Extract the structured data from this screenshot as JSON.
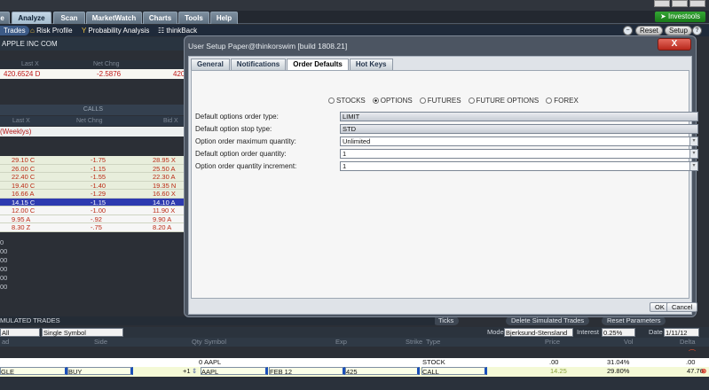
{
  "menu": {
    "tabs": [
      {
        "label": "le"
      },
      {
        "label": "Analyze"
      },
      {
        "label": "Scan"
      },
      {
        "label": "MarketWatch"
      },
      {
        "label": "Charts"
      },
      {
        "label": "Tools"
      },
      {
        "label": "Help"
      }
    ],
    "investools_label": "Investools"
  },
  "subtabs": {
    "trades": "Trades",
    "risk_profile": "Risk Profile",
    "probability": "Probability Analysis",
    "thinkback": "thinkBack",
    "reset": "Reset",
    "setup": "Setup"
  },
  "left": {
    "symbol": "APPLE INC COM",
    "quote_headers": {
      "last": "Last X",
      "net": "Net Chng"
    },
    "quote": {
      "last": "420.6524 D",
      "net": "-2.5876",
      "extra": "420"
    },
    "calls_label": "CALLS",
    "col_headers": {
      "last": "Last X",
      "net": "Net Chng",
      "bid": "Bid X"
    },
    "weeklys": "(Weeklys)",
    "chain": [
      {
        "last": "29.10 C",
        "net": "-1.75",
        "bid": "28.95 X"
      },
      {
        "last": "26.00 C",
        "net": "-1.15",
        "bid": "25.50 A"
      },
      {
        "last": "22.40 C",
        "net": "-1.55",
        "bid": "22.30 A"
      },
      {
        "last": "19.40 C",
        "net": "-1.40",
        "bid": "19.35 N"
      },
      {
        "last": "16.66 A",
        "net": "-1.29",
        "bid": "16.60 X"
      },
      {
        "last": "14.15 C",
        "net": "-1.15",
        "bid": "14.10 A"
      },
      {
        "last": "12.00 C",
        "net": "-1.00",
        "bid": "11.90 X"
      },
      {
        "last": "9.95 A",
        "net": "-.92",
        "bid": "9.90 A"
      },
      {
        "last": "8.30 Z",
        "net": "-.75",
        "bid": "8.20 A"
      }
    ],
    "zeros": [
      "0",
      "00",
      "00",
      "00",
      "00",
      "00"
    ]
  },
  "dialog": {
    "title": "User Setup Paper@thinkorswim [build 1808.21]",
    "close_label": "X",
    "tabs": [
      {
        "label": "General"
      },
      {
        "label": "Notifications"
      },
      {
        "label": "Order Defaults"
      },
      {
        "label": "Hot Keys"
      }
    ],
    "asset_types": [
      {
        "label": "STOCKS"
      },
      {
        "label": "OPTIONS"
      },
      {
        "label": "FUTURES"
      },
      {
        "label": "FUTURE OPTIONS"
      },
      {
        "label": "FOREX"
      }
    ],
    "fields": [
      {
        "label": "Default options order type:",
        "value": "LIMIT"
      },
      {
        "label": "Default option stop type:",
        "value": "STD"
      },
      {
        "label": "Option order maximum quantity:",
        "value": "Unlimited"
      },
      {
        "label": "Default option order quantity:",
        "value": "1"
      },
      {
        "label": "Option order quantity increment:",
        "value": "1"
      }
    ],
    "ok_label": "OK",
    "cancel_label": "Cancel"
  },
  "behind": {
    "delete_label": "Delete Simulated Trades",
    "reset_params": "Reset Parameters",
    "ticks_label": "Ticks"
  },
  "sim": {
    "header": "MULATED TRADES",
    "filter_all": "All",
    "filter_symbol": "Single Symbol",
    "model_label": "Model",
    "model_value": "Bjerksund-Stensland",
    "interest_label": "Interest",
    "interest_value": "0.25%",
    "date_label": "Date",
    "date_value": "1/11/12",
    "columns": {
      "trade": "ad",
      "side": "Side",
      "qty": "Qty",
      "symbol": "Symbol",
      "exp": "Exp",
      "strike": "Strike",
      "type": "Type",
      "price": "Price",
      "vol": "Vol",
      "delta": "Delta"
    },
    "rows": [
      {
        "trade": "",
        "side": "",
        "qty": "0",
        "symbol": "AAPL",
        "exp": "",
        "strike": "",
        "type": "STOCK",
        "price": ".00",
        "vol": "31.04%",
        "delta": ".00"
      },
      {
        "trade": "GLE",
        "side": "BUY",
        "qty": "+1",
        "symbol": "AAPL",
        "exp": "FEB 12",
        "strike": "425",
        "type": "CALL",
        "price": "14.25",
        "vol": "29.80%",
        "delta": "47.76"
      }
    ]
  }
}
